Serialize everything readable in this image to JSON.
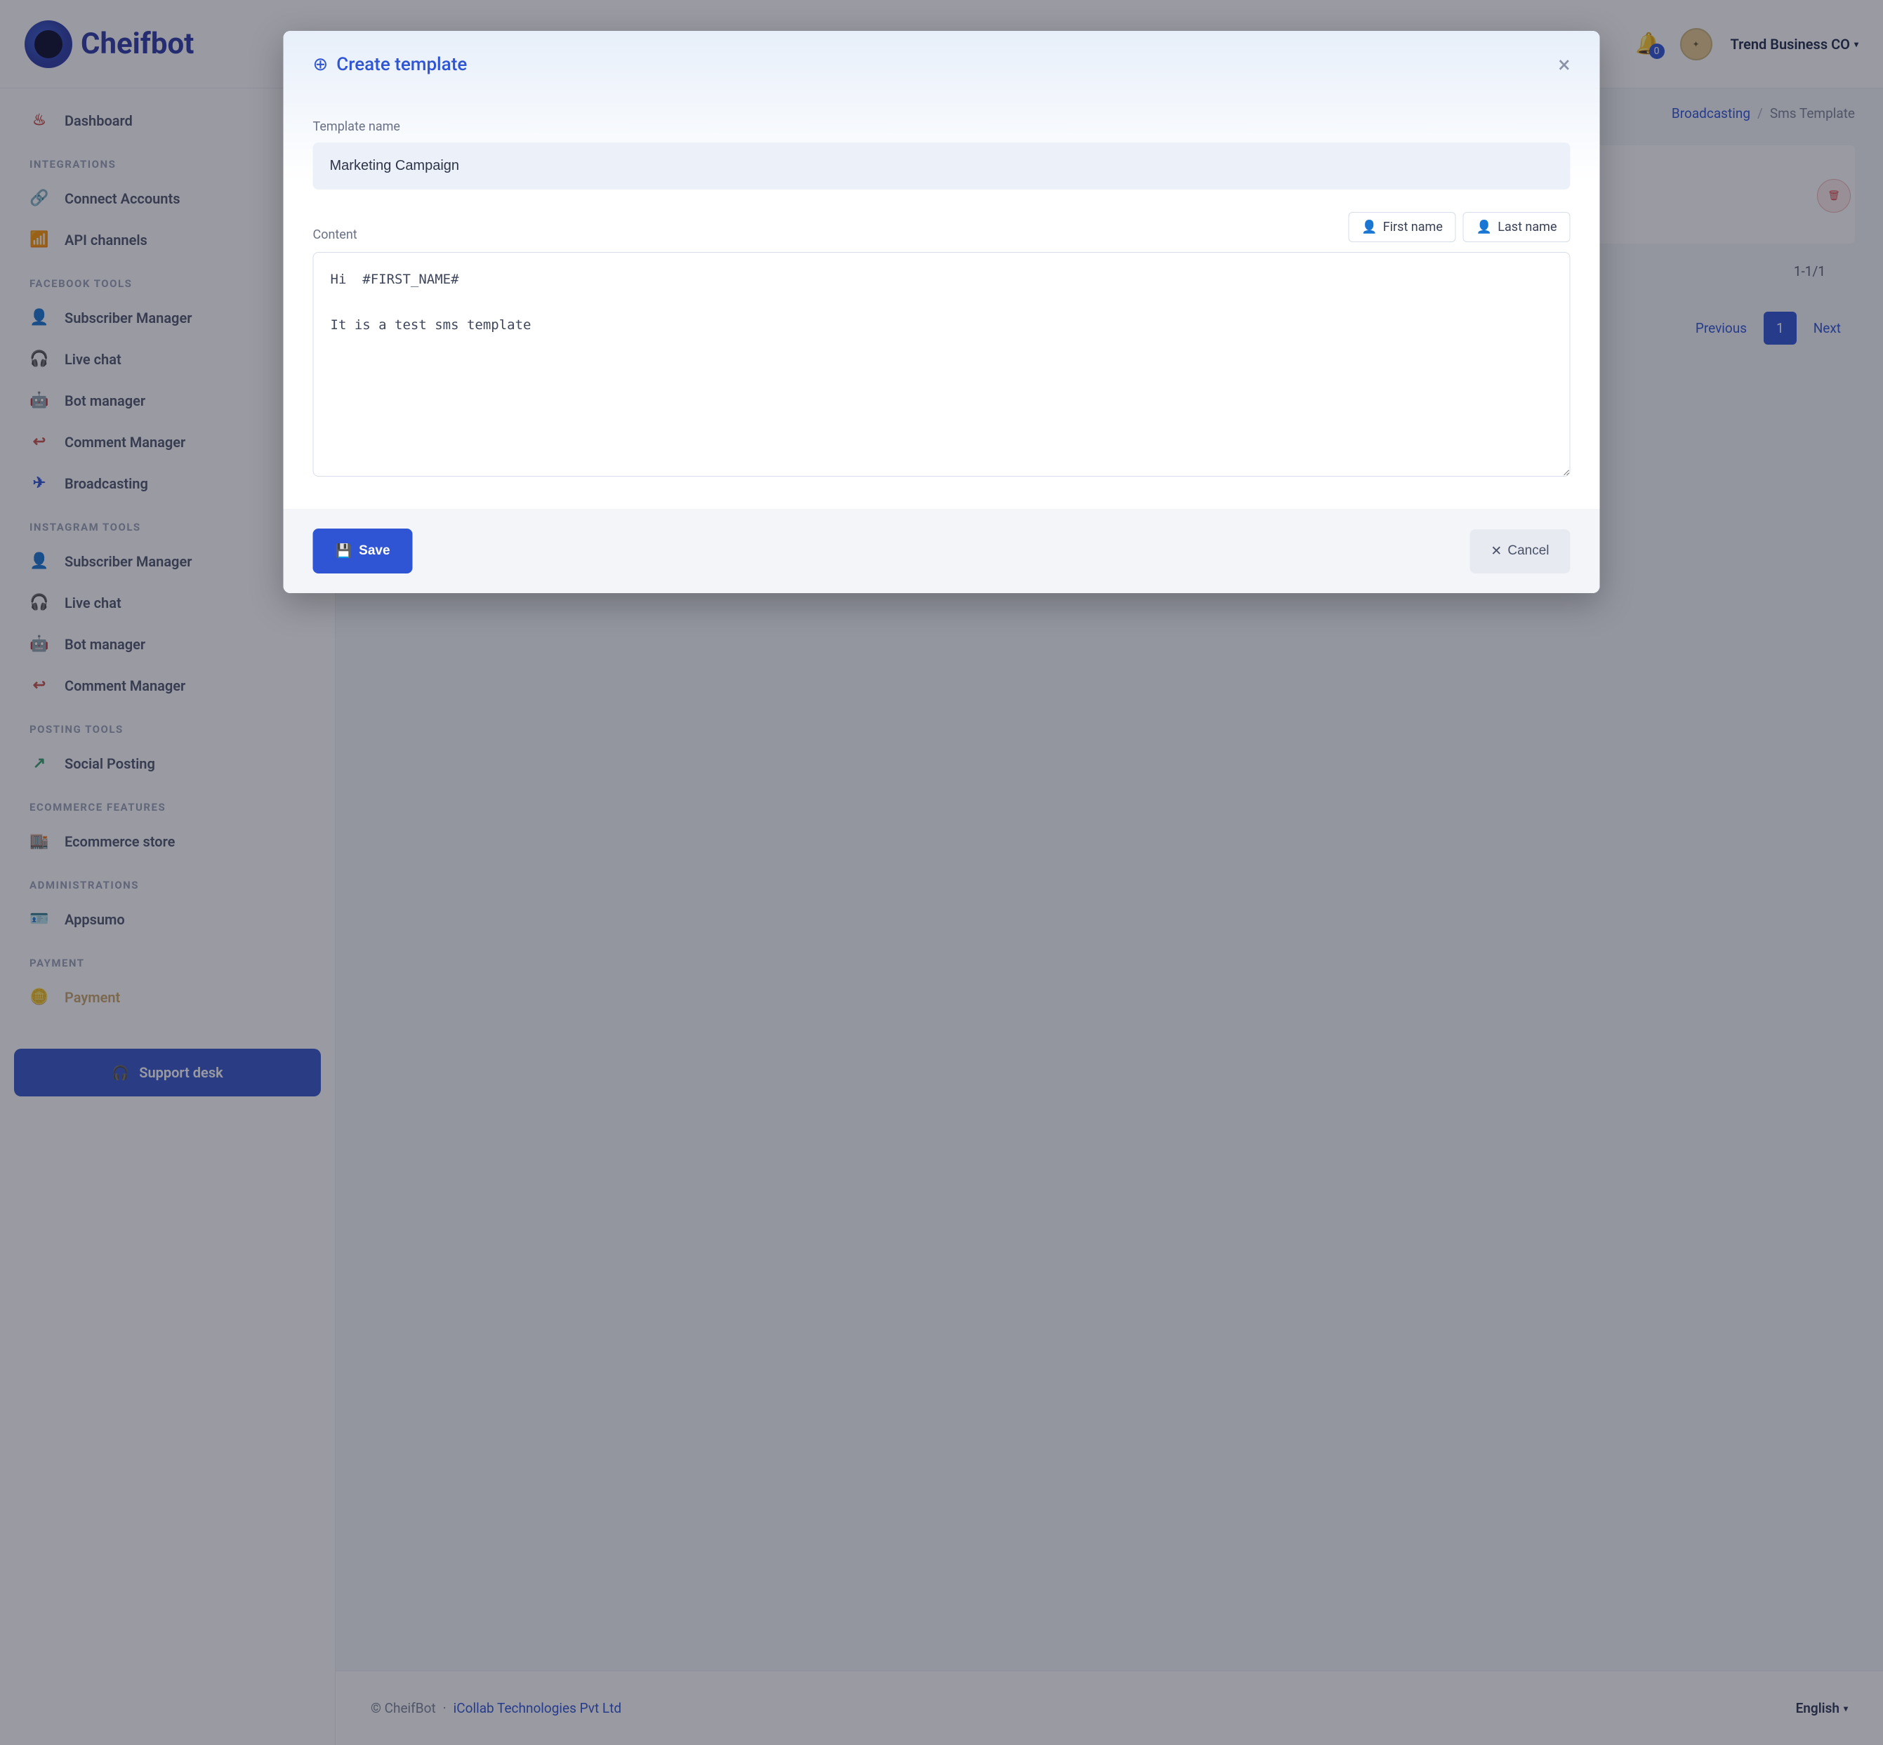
{
  "brand": {
    "name": "Cheifbot"
  },
  "topbar": {
    "notif_count": "0",
    "account": "Trend Business CO"
  },
  "sidebar": {
    "dashboard": "Dashboard",
    "sec_integrations": "INTEGRATIONS",
    "connect_accounts": "Connect Accounts",
    "api_channels": "API channels",
    "sec_fb": "FACEBOOK TOOLS",
    "fb_sub": "Subscriber Manager",
    "fb_live": "Live chat",
    "fb_bot": "Bot manager",
    "fb_comment": "Comment Manager",
    "fb_broadcast": "Broadcasting",
    "sec_ig": "INSTAGRAM TOOLS",
    "ig_sub": "Subscriber Manager",
    "ig_live": "Live chat",
    "ig_bot": "Bot manager",
    "ig_comment": "Comment Manager",
    "sec_posting": "POSTING TOOLS",
    "social_posting": "Social Posting",
    "sec_ecom": "ECOMMERCE FEATURES",
    "ecom_store": "Ecommerce store",
    "sec_admin": "ADMINISTRATIONS",
    "appsumo": "Appsumo",
    "sec_payment": "PAYMENT",
    "payment": "Payment",
    "support": "Support desk"
  },
  "crumbs": {
    "a": "Broadcasting",
    "b": "Sms Template"
  },
  "pager": {
    "stat": "1-1/1",
    "prev": "Previous",
    "page": "1",
    "next": "Next"
  },
  "footer": {
    "copy": "© CheifBot",
    "company": "iCollab Technologies Pvt Ltd",
    "lang": "English"
  },
  "modal": {
    "title": "Create template",
    "label_name": "Template name",
    "name_value": "Marketing Campaign",
    "label_content": "Content",
    "tag_first": "First name",
    "tag_last": "Last name",
    "content_value": "Hi  #FIRST_NAME#\n\nIt is a test sms template",
    "save": "Save",
    "cancel": "Cancel"
  }
}
